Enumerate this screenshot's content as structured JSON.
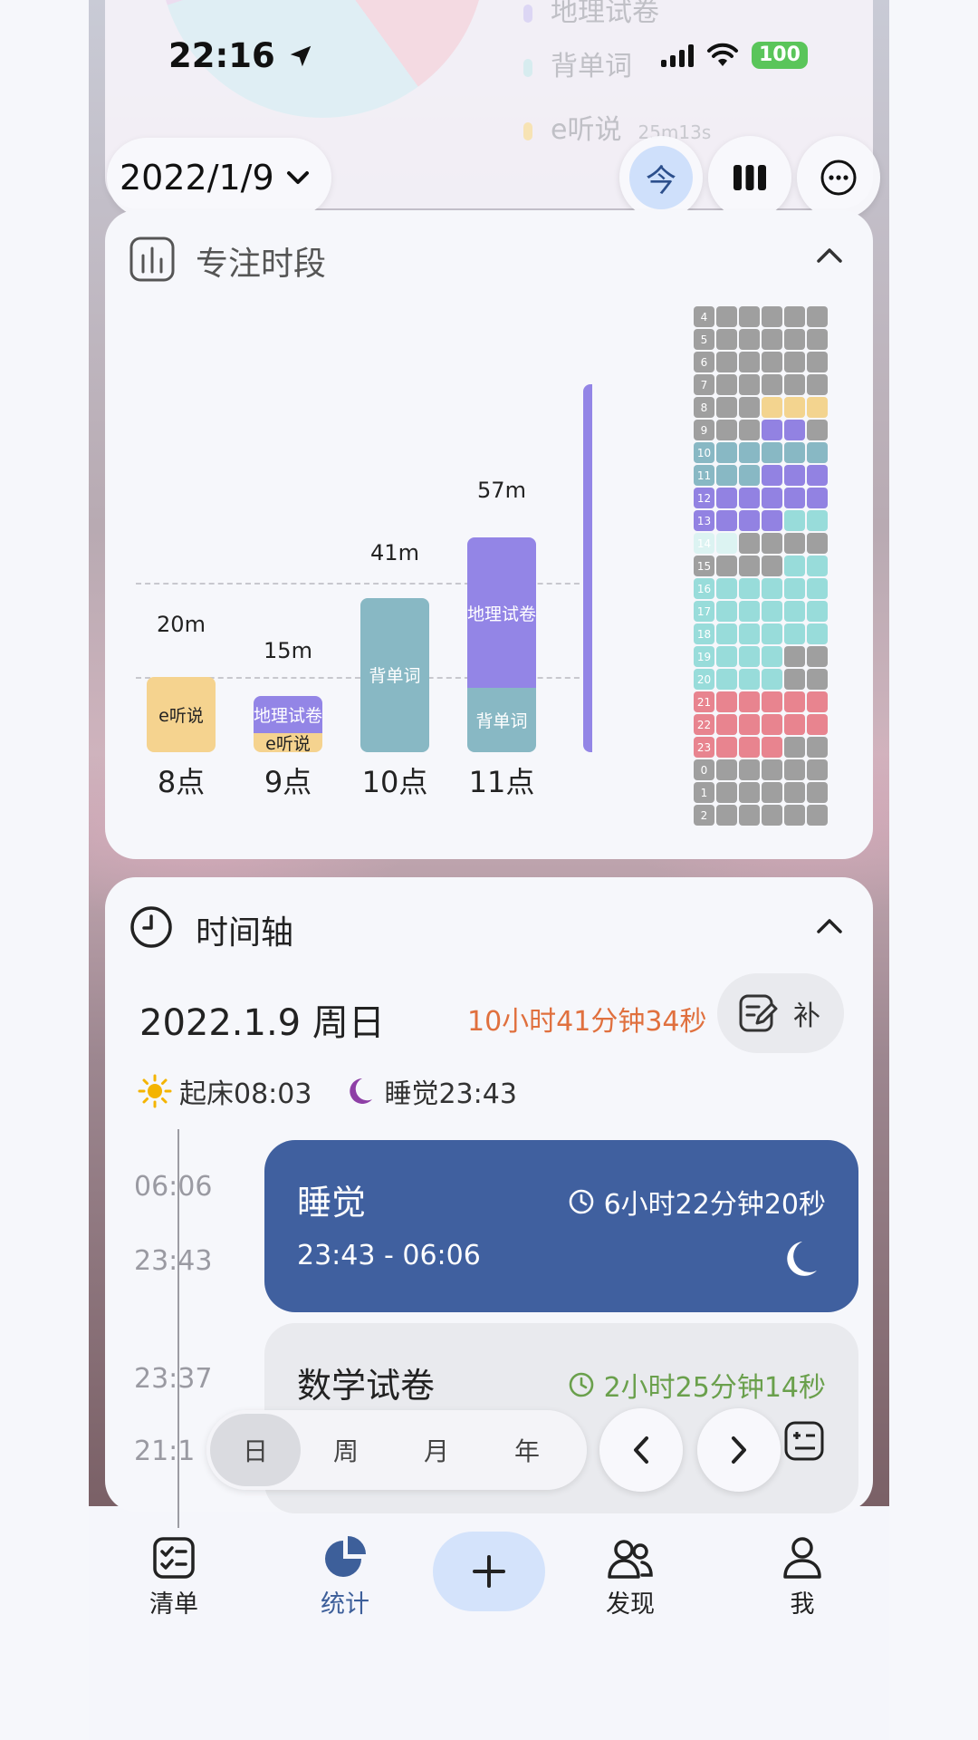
{
  "status_bar": {
    "time": "22:16",
    "battery": "100"
  },
  "ghost_legend": [
    {
      "label": "地理试卷",
      "color": "#dcd6f4",
      "duration": ""
    },
    {
      "label": "背单词",
      "color": "#d7ecef",
      "duration": ""
    },
    {
      "label": "e听说",
      "color": "#f7e3b4",
      "duration": "25m13s"
    }
  ],
  "header": {
    "date": "2022/1/9",
    "today_label": "今"
  },
  "focus_card": {
    "title": "专注时段",
    "chart_data": {
      "type": "bar",
      "categories": [
        "8点",
        "9点",
        "10点",
        "11点"
      ],
      "series": [
        {
          "name": "e听说",
          "color": "#f5d38f",
          "values": [
            20,
            5,
            0,
            0
          ]
        },
        {
          "name": "背单词",
          "color": "#88b8c4",
          "values": [
            0,
            0,
            41,
            17
          ]
        },
        {
          "name": "地理试卷",
          "color": "#9385e6",
          "values": [
            0,
            10,
            0,
            40
          ]
        }
      ],
      "totals": [
        "20m",
        "15m",
        "41m",
        "57m"
      ],
      "ylim": [
        0,
        60
      ],
      "reference_lines": [
        20,
        45
      ]
    },
    "heatmap": {
      "rows": [
        {
          "label": "4",
          "cells": [
            "gray",
            "gray",
            "gray",
            "gray",
            "gray"
          ]
        },
        {
          "label": "5",
          "cells": [
            "gray",
            "gray",
            "gray",
            "gray",
            "gray"
          ]
        },
        {
          "label": "6",
          "cells": [
            "gray",
            "gray",
            "gray",
            "gray",
            "gray"
          ]
        },
        {
          "label": "7",
          "cells": [
            "gray",
            "gray",
            "gray",
            "gray",
            "gray"
          ]
        },
        {
          "label": "8",
          "cells": [
            "gray",
            "gray",
            "yellow",
            "yellow",
            "yellow"
          ]
        },
        {
          "label": "9",
          "cells": [
            "gray",
            "gray",
            "purple",
            "purple",
            "gray"
          ]
        },
        {
          "label": "10",
          "cells": [
            "teal",
            "teal",
            "teal",
            "teal",
            "teal"
          ]
        },
        {
          "label": "11",
          "cells": [
            "teal",
            "teal",
            "purple",
            "purple",
            "purple"
          ]
        },
        {
          "label": "12",
          "cells": [
            "purple",
            "purple",
            "purple",
            "purple",
            "purple"
          ]
        },
        {
          "label": "13",
          "cells": [
            "purple",
            "purple",
            "purple",
            "mint",
            "mint"
          ]
        },
        {
          "label": "14",
          "cells": [
            "lightmint",
            "gray",
            "gray",
            "gray",
            "gray"
          ]
        },
        {
          "label": "15",
          "cells": [
            "gray",
            "gray",
            "gray",
            "mint",
            "mint"
          ]
        },
        {
          "label": "16",
          "cells": [
            "mint",
            "mint",
            "mint",
            "mint",
            "mint"
          ]
        },
        {
          "label": "17",
          "cells": [
            "mint",
            "mint",
            "mint",
            "mint",
            "mint"
          ]
        },
        {
          "label": "18",
          "cells": [
            "mint",
            "mint",
            "mint",
            "mint",
            "mint"
          ]
        },
        {
          "label": "19",
          "cells": [
            "mint",
            "mint",
            "mint",
            "gray",
            "gray"
          ]
        },
        {
          "label": "20",
          "cells": [
            "mint",
            "mint",
            "mint",
            "gray",
            "gray"
          ]
        },
        {
          "label": "21",
          "cells": [
            "pink",
            "pink",
            "pink",
            "pink",
            "pink"
          ]
        },
        {
          "label": "22",
          "cells": [
            "pink",
            "pink",
            "pink",
            "pink",
            "pink"
          ]
        },
        {
          "label": "23",
          "cells": [
            "pink",
            "pink",
            "pink",
            "gray",
            "gray"
          ]
        },
        {
          "label": "0",
          "cells": [
            "gray",
            "gray",
            "gray",
            "gray",
            "gray"
          ]
        },
        {
          "label": "1",
          "cells": [
            "gray",
            "gray",
            "gray",
            "gray",
            "gray"
          ]
        },
        {
          "label": "2",
          "cells": [
            "gray",
            "gray",
            "gray",
            "gray",
            "gray"
          ]
        }
      ],
      "colors": {
        "gray": "#9f9f9f",
        "yellow": "#f3d48f",
        "purple": "#9282e2",
        "teal": "#88b8c4",
        "mint": "#98dcda",
        "lightmint": "#dcf3f2",
        "pink": "#e8848f"
      }
    }
  },
  "timeline_card": {
    "title": "时间轴",
    "date": "2022.1.9 周日",
    "total": "10小时41分钟34秒",
    "add_label": "补",
    "wake": "起床08:03",
    "sleep": "睡觉23:43",
    "times": [
      "06:06",
      "23:43",
      "23:37",
      "21:1"
    ],
    "entries": [
      {
        "title": "睡觉",
        "duration": "6小时22分钟20秒",
        "range": "23:43 - 06:06"
      },
      {
        "title": "数学试卷",
        "duration": "2小时25分钟14秒"
      }
    ]
  },
  "period_selector": {
    "options": [
      "日",
      "周",
      "月",
      "年"
    ],
    "active": "日"
  },
  "tab_bar": {
    "items": [
      "清单",
      "统计",
      "发现",
      "我"
    ],
    "active": "统计"
  }
}
